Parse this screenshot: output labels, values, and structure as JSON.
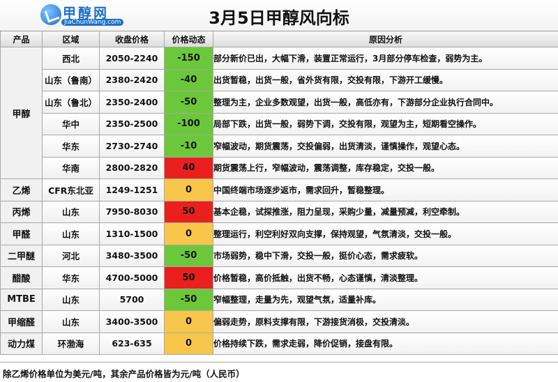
{
  "header": {
    "logo_text": "甲醇网",
    "logo_url": "JiaChunWang.com",
    "title": "3月5日甲醇风向标"
  },
  "table": {
    "columns": [
      "产品",
      "区域",
      "收盘价格",
      "价格动态",
      "原因分析"
    ],
    "rows": [
      {
        "product": "甲醇",
        "region": "西北",
        "price": "2050-2240",
        "change": "-150",
        "trend": "down",
        "reason": "部分新价已出，大幅下滑，装置正常运行，3月部分停车检查，弱势为主。"
      },
      {
        "product": "",
        "region": "山东（鲁南）",
        "price": "2380-2420",
        "change": "-40",
        "trend": "down",
        "reason": "出货暂稳，出货一般，省外货有限，交投有限，下游开工缓慢。"
      },
      {
        "product": "",
        "region": "山东（鲁北）",
        "price": "2350-2400",
        "change": "-50",
        "trend": "down",
        "reason": "整理为主，企业多数观望，出货一般，高低亦有，下游部分企业执行合同中。"
      },
      {
        "product": "",
        "region": "华中",
        "price": "2350-2500",
        "change": "-100",
        "trend": "down",
        "reason": "局部下跌，出货一般，弱势下调，交投有限，观望为主，短期看空操作。"
      },
      {
        "product": "",
        "region": "华东",
        "price": "2730-2740",
        "change": "-10",
        "trend": "down",
        "reason": "窄幅波动，期货震荡，交投偏弱，出货清淡，谨慎操作，观望心态。"
      },
      {
        "product": "",
        "region": "华南",
        "price": "2800-2820",
        "change": "40",
        "trend": "up",
        "reason": "期货震荡上行，窄幅波动，震荡调整，库存稳定，交投一般。"
      },
      {
        "product": "乙烯",
        "region": "CFR东北亚",
        "price": "1249-1251",
        "change": "0",
        "trend": "flat",
        "reason": "中国终端市场逐步返市，需求回升，暂稳整理。"
      },
      {
        "product": "丙烯",
        "region": "山东",
        "price": "7950-8030",
        "change": "50",
        "trend": "up",
        "reason": "基本企稳，试探推涨，阻力呈现，采购少量，减量预减，利空牵制。"
      },
      {
        "product": "甲醛",
        "region": "山东",
        "price": "1310-1500",
        "change": "0",
        "trend": "flat",
        "reason": "整理运行，利空利好双向支撑，保持观望，气氛清淡，交投一般。"
      },
      {
        "product": "二甲醚",
        "region": "河北",
        "price": "3480-3500",
        "change": "-50",
        "trend": "down",
        "reason": "市场弱势，稳中下滑，交投一般，挺价心态，需求疲软。"
      },
      {
        "product": "醋酸",
        "region": "华东",
        "price": "4700-5000",
        "change": "50",
        "trend": "up",
        "reason": "价格暂稳，高价抵触，出货不畅，心态谨慎，清淡整理。"
      },
      {
        "product": "MTBE",
        "region": "山东",
        "price": "5700",
        "change": "-50",
        "trend": "down",
        "reason": "窄幅整理，走量为先，观望气氛，适量补库。"
      },
      {
        "product": "甲缩醛",
        "region": "山东",
        "price": "3400-3500",
        "change": "0",
        "trend": "flat",
        "reason": "偏弱走势，原料支撑有限，下游接货消极，交投清淡。"
      },
      {
        "product": "动力煤",
        "region": "环渤海",
        "price": "623-635",
        "change": "0",
        "trend": "flat",
        "reason": "价格持续下跌，需求走弱，降价促销，接盘有限。"
      }
    ]
  },
  "footer": {
    "note": "除乙烯价格单位为美元/吨，其余产品价格皆为元/吨（人民币）"
  },
  "colors": {
    "down": "#6cc83b",
    "up": "#e9201e",
    "flat": "#f7c64a"
  }
}
